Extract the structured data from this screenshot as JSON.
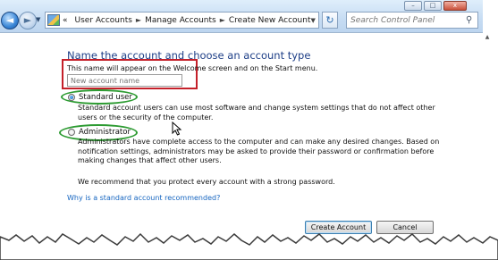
{
  "window": {
    "controls": [
      "–",
      "□",
      "x"
    ]
  },
  "nav": {
    "back_glyph": "◄",
    "forward_glyph": "►",
    "breadcrumb_prefix": "«",
    "breadcrumbs": [
      "User Accounts",
      "Manage Accounts",
      "Create New Account"
    ],
    "separator": "►",
    "refresh_glyph": "↻",
    "search_placeholder": "Search Control Panel",
    "search_icon_glyph": "⚲"
  },
  "form": {
    "heading": "Name the account and choose an account type",
    "name_note": "This name will appear on the Welcome screen and on the Start menu.",
    "name_placeholder": "New account name",
    "account_types": [
      {
        "label": "Standard user",
        "selected": true,
        "description": "Standard account users can use most software and change system settings that do not affect other users or the security of the computer."
      },
      {
        "label": "Administrator",
        "selected": false,
        "description": "Administrators have complete access to the computer and can make any desired changes. Based on notification settings, administrators may be asked to provide their password or confirmation before making changes that affect other users."
      }
    ],
    "recommendation": "We recommend that you protect every account with a strong password.",
    "help_link": "Why is a standard account recommended?",
    "create_button": "Create Account",
    "cancel_button": "Cancel"
  },
  "annotation_colors": {
    "red_box": "#c4202a",
    "green_ellipse": "#2d9b32"
  }
}
